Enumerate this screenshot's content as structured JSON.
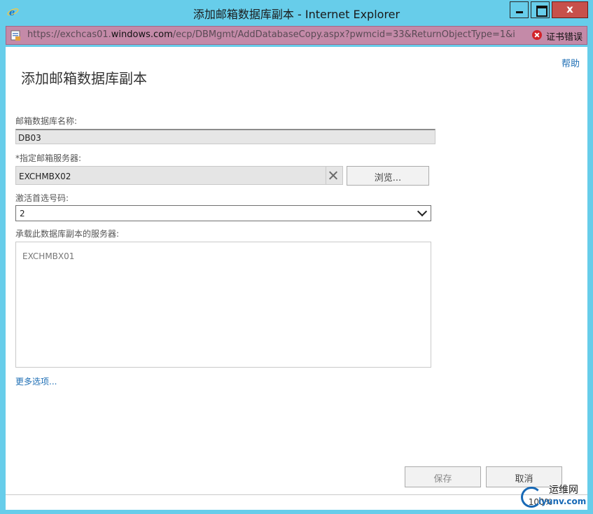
{
  "window": {
    "title": "添加邮箱数据库副本 - Internet Explorer",
    "close_glyph": "x"
  },
  "address": {
    "url_prefix": "https://exchcas01.",
    "url_domain": "windows.com",
    "url_suffix": "/ecp/DBMgmt/AddDatabaseCopy.aspx?pwmcid=33&ReturnObjectType=1&i",
    "cert_error": "证书错误"
  },
  "page": {
    "help": "帮助",
    "title": "添加邮箱数据库副本"
  },
  "form": {
    "db_name_label": "邮箱数据库名称:",
    "db_name_value": "DB03",
    "server_label": "*指定邮箱服务器:",
    "server_value": "EXCHMBX02",
    "browse": "浏览...",
    "activation_label": "激活首选号码:",
    "activation_value": "2",
    "hosting_label": "承载此数据库副本的服务器:",
    "hosting_servers": [
      "EXCHMBX01"
    ],
    "more_options": "更多选项..."
  },
  "footer": {
    "save": "保存",
    "cancel": "取消"
  },
  "statusbar": {
    "zoom": "100%"
  },
  "watermark": {
    "line1": "运维网",
    "line2": "iyunv.com"
  },
  "colors": {
    "window_frame": "#67cdea",
    "address_bar": "#c48aa8",
    "link": "#1f6fb5",
    "close_button": "#c7504b",
    "cert_error_icon": "#d2232a"
  },
  "icons": [
    "ie-logo-icon",
    "page-icon",
    "cert-error-icon",
    "clear-icon",
    "chevron-down-icon"
  ]
}
